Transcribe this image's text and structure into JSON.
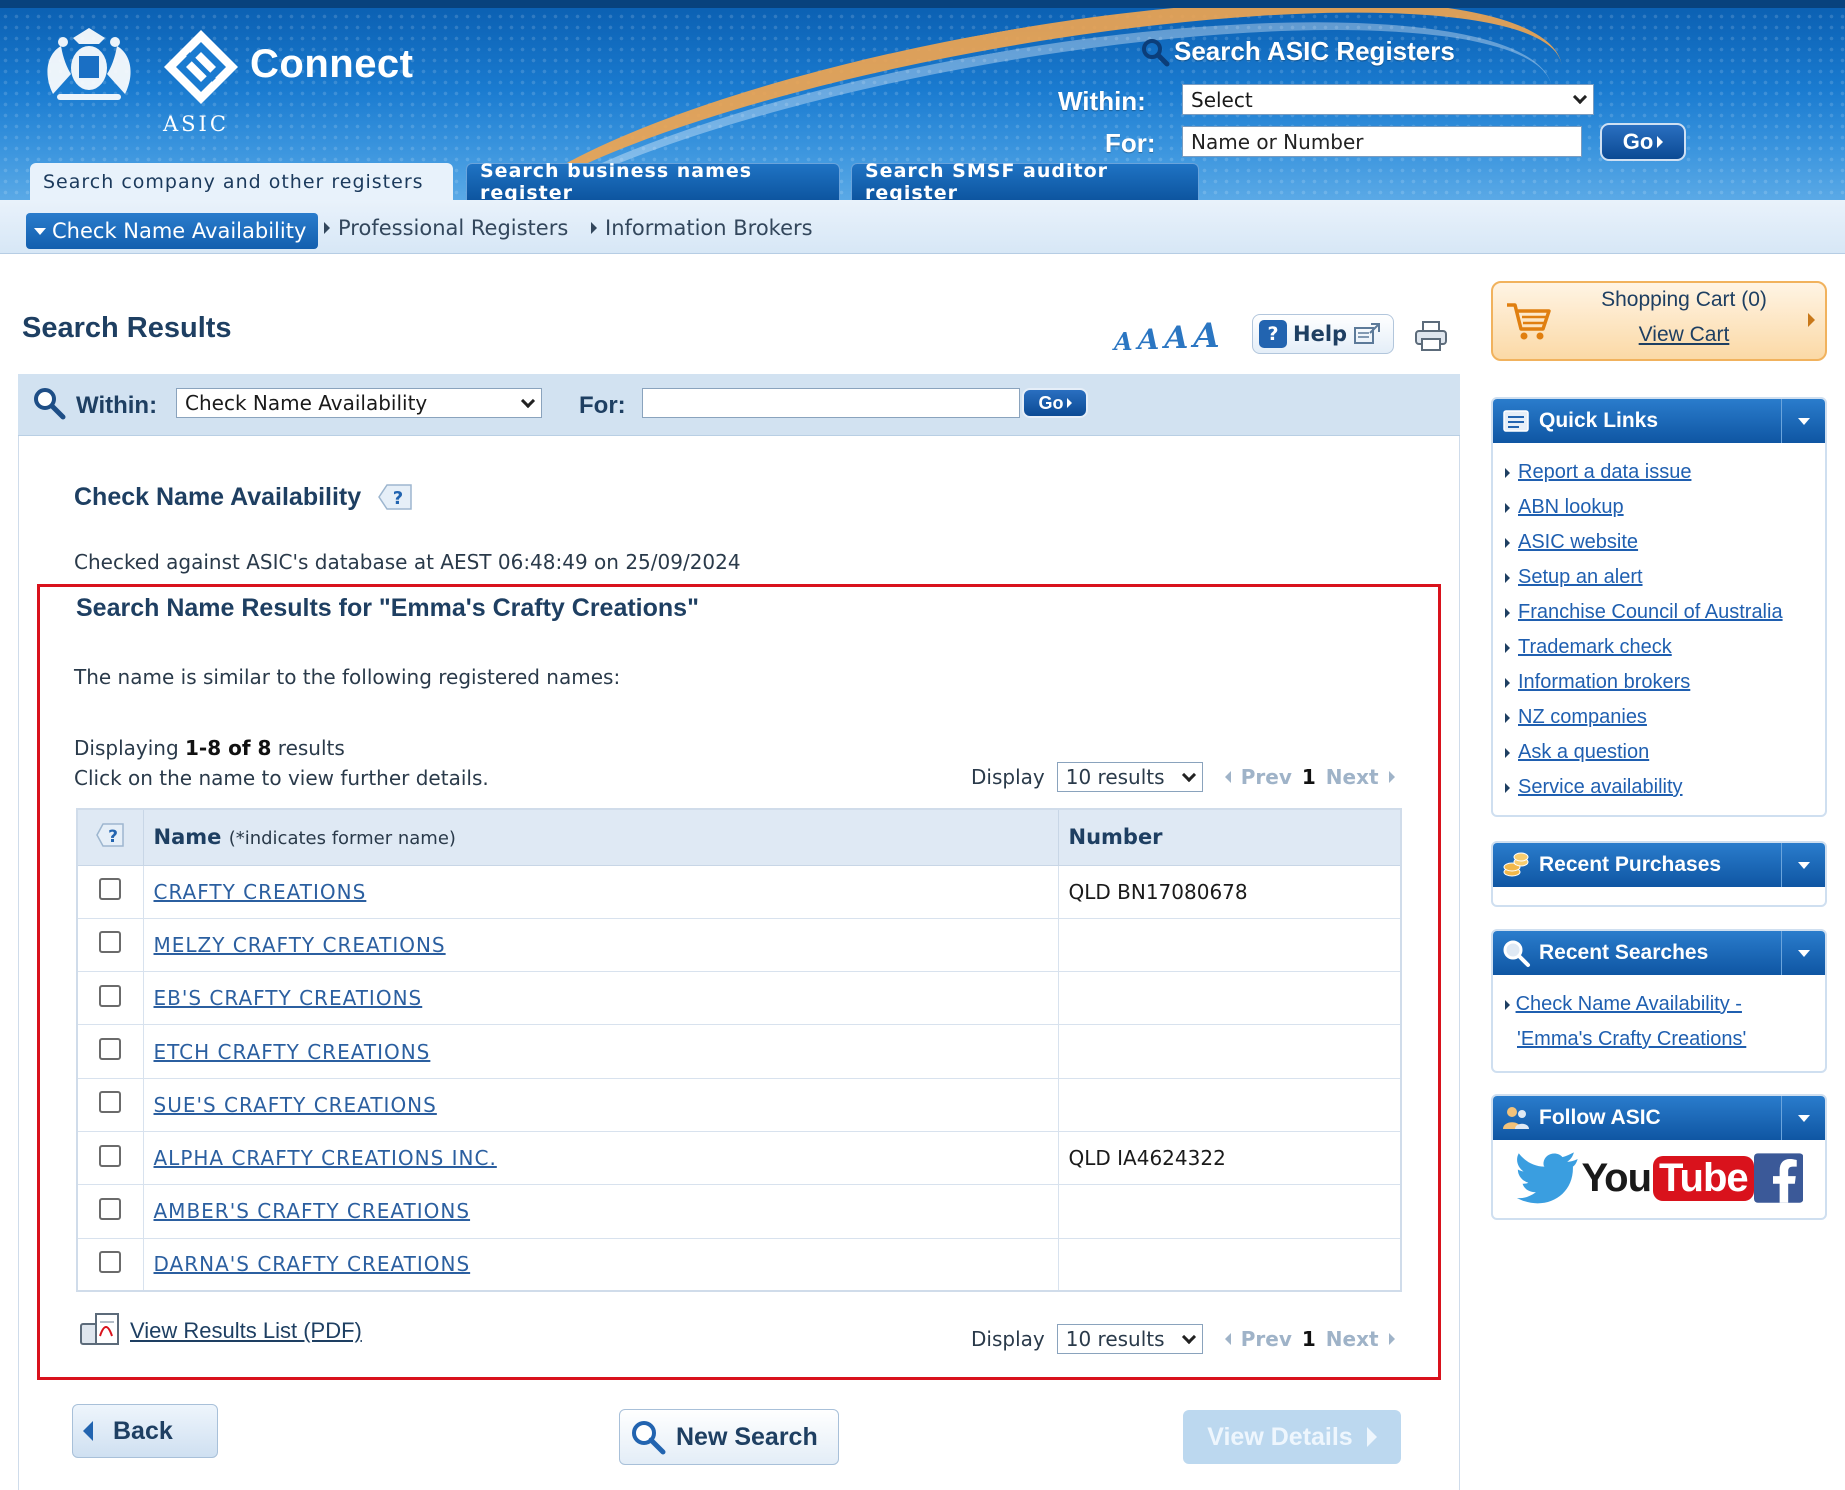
{
  "header": {
    "brand": "Connect",
    "org": "ASIC",
    "search_title": "Search ASIC Registers",
    "within_label": "Within:",
    "within_value": "Select",
    "for_label": "For:",
    "for_placeholder": "Name or Number",
    "go_label": "Go"
  },
  "tabs": [
    {
      "label": "Search company and other registers",
      "active": true
    },
    {
      "label": "Search business names register",
      "active": false
    },
    {
      "label": "Search SMSF auditor register",
      "active": false
    }
  ],
  "subnav": {
    "active": "Check Name Availability",
    "links": [
      "Professional Registers",
      "Information Brokers"
    ]
  },
  "page": {
    "title": "Search Results",
    "font_sizes": [
      "A",
      "A",
      "A",
      "A"
    ],
    "help_label": "Help"
  },
  "searchbar": {
    "within_label": "Within:",
    "within_value": "Check Name Availability",
    "for_label": "For:",
    "for_value": "",
    "go_label": "Go"
  },
  "results": {
    "section_title": "Check Name Availability",
    "checked_text": "Checked against ASIC's database at AEST 06:48:49 on 25/09/2024",
    "heading": "Search Name Results for \"Emma's Crafty Creations\"",
    "similar_text": "The name is similar to the following registered names:",
    "displaying_prefix": "Displaying",
    "displaying_range": "1-8 of 8",
    "displaying_suffix": "results",
    "click_text": "Click on the name to view further details.",
    "pager": {
      "display_label": "Display",
      "display_value": "10 results",
      "prev": "Prev",
      "current": "1",
      "next": "Next"
    },
    "columns": {
      "help": "?",
      "name": "Name",
      "name_note": "(*indicates former name)",
      "number": "Number"
    },
    "rows": [
      {
        "name": "CRAFTY CREATIONS",
        "number": "QLD BN17080678"
      },
      {
        "name": "MELZY CRAFTY CREATIONS",
        "number": ""
      },
      {
        "name": "EB'S CRAFTY CREATIONS",
        "number": ""
      },
      {
        "name": "ETCH CRAFTY CREATIONS",
        "number": ""
      },
      {
        "name": "SUE'S CRAFTY CREATIONS",
        "number": ""
      },
      {
        "name": "ALPHA CRAFTY CREATIONS INC.",
        "number": "QLD IA4624322"
      },
      {
        "name": "AMBER'S CRAFTY CREATIONS",
        "number": ""
      },
      {
        "name": "DARNA'S CRAFTY CREATIONS",
        "number": ""
      }
    ],
    "pdf_link": "View Results List (PDF)"
  },
  "actions": {
    "back": "Back",
    "new_search": "New Search",
    "view_details": "View Details"
  },
  "sidebar": {
    "cart": {
      "title": "Shopping Cart (0)",
      "view": "View Cart"
    },
    "quick_links": {
      "title": "Quick Links",
      "items": [
        "Report a data issue",
        "ABN lookup",
        "ASIC website",
        "Setup an alert",
        "Franchise Council of Australia",
        "Trademark check",
        "Information brokers",
        "NZ companies",
        "Ask a question",
        "Service availability"
      ]
    },
    "recent_purchases": {
      "title": "Recent Purchases"
    },
    "recent_searches": {
      "title": "Recent Searches",
      "item_line1": "Check Name Availability -",
      "item_line2": "'Emma's Crafty Creations'"
    },
    "follow": {
      "title": "Follow ASIC",
      "youtube_you": "You",
      "youtube_tube": "Tube"
    }
  },
  "colors": {
    "header_blue": "#1a7bd0",
    "accent_orange": "#f2a650",
    "link_blue": "#2b5fa0",
    "highlight_red": "#d9121c"
  }
}
